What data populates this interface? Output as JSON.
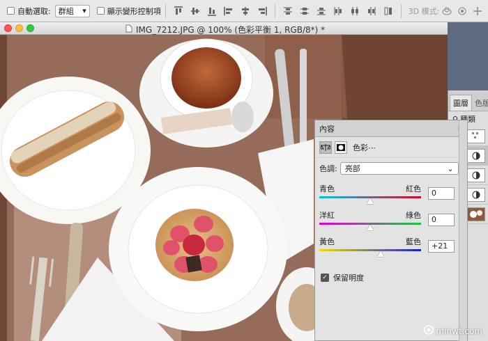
{
  "options_bar": {
    "auto_select_label": "自動選取:",
    "auto_select_target": "群組",
    "show_transform_label": "顯示變形控制項",
    "mode_3d_label": "3D 模式:"
  },
  "document": {
    "title": "IMG_7212.JPG @ 100% (色彩平衡 1, RGB/8*) *"
  },
  "layers_panel": {
    "tabs": [
      "圖層",
      "色版"
    ],
    "kind_filter": "種類"
  },
  "properties_panel": {
    "tab_label": "內容",
    "adjustment_name": "色彩⋯",
    "tone_label": "色調:",
    "tone_value": "亮部",
    "sliders": [
      {
        "left": "青色",
        "right": "紅色",
        "value": "0",
        "level": 0
      },
      {
        "left": "洋紅",
        "right": "綠色",
        "value": "0",
        "level": 0
      },
      {
        "left": "黃色",
        "right": "藍色",
        "value": "+21",
        "level": 21
      }
    ],
    "preserve_luminosity_label": "保留明度",
    "preserve_luminosity_checked": true
  },
  "watermark": {
    "text": "minwt.com"
  }
}
